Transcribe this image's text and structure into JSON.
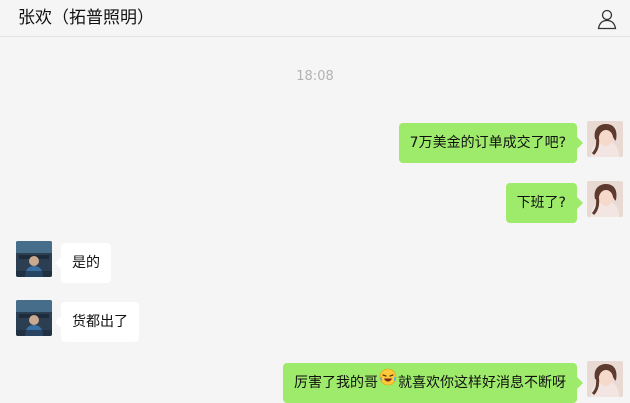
{
  "header": {
    "title": "张欢（拓普照明）",
    "profile_icon": "person-icon"
  },
  "chat": {
    "timestamp": "18:08",
    "messages": [
      {
        "from": "me",
        "text": "7万美金的订单成交了吧?"
      },
      {
        "from": "me",
        "text": "下班了?"
      },
      {
        "from": "contact",
        "text": "是的"
      },
      {
        "from": "contact",
        "text": "货都出了"
      },
      {
        "from": "me",
        "text_before": "厉害了我的哥",
        "emoji": "laughing-face-emoji",
        "text_after": "就喜欢你这样好消息不断呀"
      }
    ]
  },
  "colors": {
    "background": "#f5f5f5",
    "my_bubble": "#9eea6a",
    "contact_bubble": "#ffffff",
    "timestamp": "#b2b2b2"
  }
}
